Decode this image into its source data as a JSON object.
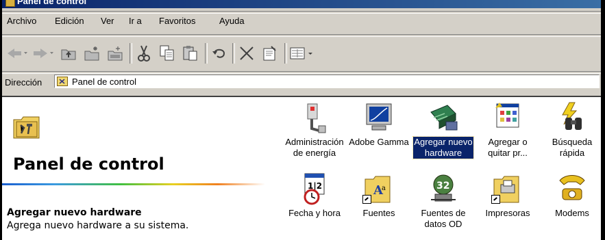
{
  "window": {
    "title": "Panel de control"
  },
  "menu": {
    "items": [
      {
        "label": "Archivo"
      },
      {
        "label": "Edición"
      },
      {
        "label": "Ver"
      },
      {
        "label": "Ir a"
      },
      {
        "label": "Favoritos"
      },
      {
        "label": "Ayuda"
      }
    ]
  },
  "toolbar": {
    "icons": [
      "back-arrow-icon",
      "forward-arrow-icon",
      "up-folder-icon",
      "new-folder-icon",
      "folder-tree-icon",
      "cut-icon",
      "copy-icon",
      "paste-icon",
      "undo-icon",
      "delete-icon",
      "properties-icon",
      "views-icon"
    ]
  },
  "address": {
    "label": "Dirección",
    "value": "Panel de control"
  },
  "left_pane": {
    "title": "Panel de control",
    "selected_title": "Agregar nuevo hardware",
    "selected_desc": "Agrega nuevo hardware a su sistema."
  },
  "items_row1": [
    {
      "label1": "Administración",
      "label2": "de energía"
    },
    {
      "label1": "Adobe Gamma",
      "label2": ""
    },
    {
      "label1": "Agregar nuevo",
      "label2": "hardware"
    },
    {
      "label1": "Agregar o",
      "label2": "quitar pr..."
    },
    {
      "label1": "Búsqueda",
      "label2": "rápida"
    }
  ],
  "items_row2": [
    {
      "label1": "Fecha y hora",
      "label2": ""
    },
    {
      "label1": "Fuentes",
      "label2": ""
    },
    {
      "label1": "Fuentes de",
      "label2": "datos OD"
    },
    {
      "label1": "Impresoras",
      "label2": ""
    },
    {
      "label1": "Modems",
      "label2": ""
    }
  ],
  "colors": {
    "selection": "#0a246a",
    "chrome": "#d4d0c8"
  }
}
